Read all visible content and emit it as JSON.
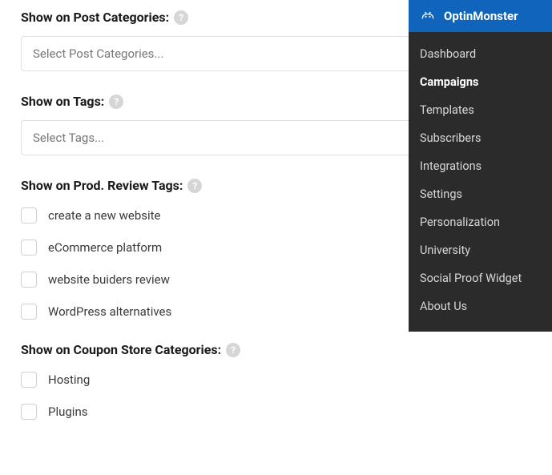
{
  "brand": {
    "title": "OptinMonster"
  },
  "sidebar": {
    "items": [
      {
        "label": "Dashboard",
        "active": false
      },
      {
        "label": "Campaigns",
        "active": true
      },
      {
        "label": "Templates",
        "active": false
      },
      {
        "label": "Subscribers",
        "active": false
      },
      {
        "label": "Integrations",
        "active": false
      },
      {
        "label": "Settings",
        "active": false
      },
      {
        "label": "Personalization",
        "active": false
      },
      {
        "label": "University",
        "active": false
      },
      {
        "label": "Social Proof Widget",
        "active": false
      },
      {
        "label": "About Us",
        "active": false
      }
    ]
  },
  "sections": {
    "postCategories": {
      "title": "Show on Post Categories:",
      "placeholder": "Select Post Categories..."
    },
    "tags": {
      "title": "Show on Tags:",
      "placeholder": "Select Tags..."
    },
    "prodReviewTags": {
      "title": "Show on Prod. Review Tags:",
      "items": [
        "create a new website",
        "eCommerce platform",
        "website buiders review",
        "WordPress alternatives"
      ]
    },
    "couponStore": {
      "title": "Show on Coupon Store Categories:",
      "items": [
        "Hosting",
        "Plugins"
      ]
    }
  },
  "helpGlyph": "?"
}
